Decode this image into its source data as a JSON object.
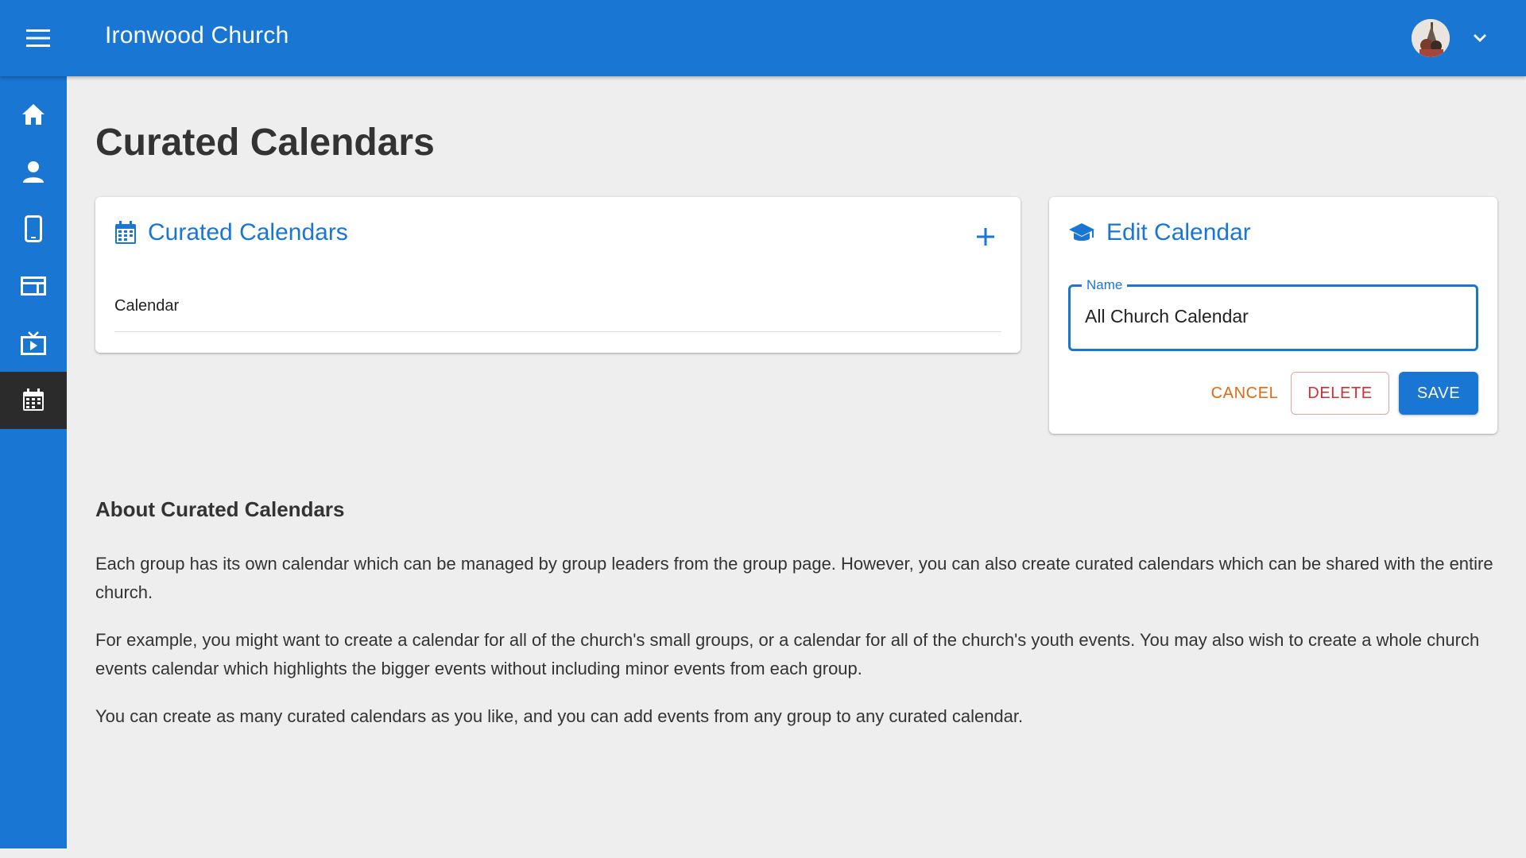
{
  "header": {
    "app_title": "Ironwood Church"
  },
  "sidebar": {
    "items": [
      {
        "name": "home",
        "icon": "home-icon",
        "active": false
      },
      {
        "name": "people",
        "icon": "person-icon",
        "active": false
      },
      {
        "name": "mobile",
        "icon": "mobile-phone-icon",
        "active": false
      },
      {
        "name": "website",
        "icon": "web-layout-icon",
        "active": false
      },
      {
        "name": "streaming",
        "icon": "live-tv-icon",
        "active": false
      },
      {
        "name": "calendars",
        "icon": "calendar-icon",
        "active": true
      }
    ]
  },
  "page": {
    "title": "Curated Calendars"
  },
  "list_card": {
    "title": "Curated Calendars",
    "items": [
      "Calendar"
    ]
  },
  "edit_card": {
    "title": "Edit Calendar",
    "name_label": "Name",
    "name_value": "All Church Calendar",
    "cancel_label": "CANCEL",
    "delete_label": "DELETE",
    "save_label": "SAVE"
  },
  "about": {
    "title": "About Curated Calendars",
    "paragraphs": [
      "Each group has its own calendar which can be managed by group leaders from the group page. However, you can also create curated calendars which can be shared with the entire church.",
      "For example, you might want to create a calendar for all of the church's small groups, or a calendar for all of the church's youth events. You may also wish to create a whole church events calendar which highlights the bigger events without including minor events from each group.",
      "You can create as many curated calendars as you like, and you can add events from any group to any curated calendar."
    ]
  },
  "colors": {
    "primary": "#1976d2",
    "sidebar_active": "#2b2b2b",
    "cancel": "#e06a10",
    "delete": "#d32f2f",
    "background": "#eeeeee"
  }
}
